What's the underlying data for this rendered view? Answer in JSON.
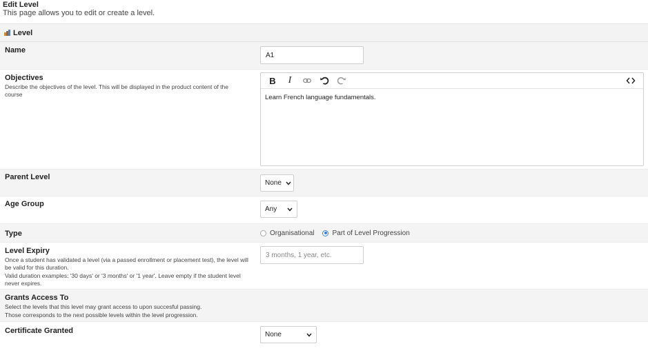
{
  "page": {
    "title": "Edit Level",
    "subtitle": "This page allows you to edit or create a level."
  },
  "section": {
    "title": "Level",
    "icon": "level-icon"
  },
  "fields": {
    "name": {
      "label": "Name",
      "value": "A1"
    },
    "objectives": {
      "label": "Objectives",
      "help": "Describe the objectives of the level. This will be displayed in the product content of the course",
      "content": "Learn French language fundamentals.",
      "toolbar": {
        "bold": "B",
        "italic": "I",
        "link_icon": "link-icon",
        "undo_icon": "undo-icon",
        "redo_icon": "redo-icon",
        "code_icon": "code-view-icon"
      }
    },
    "parent_level": {
      "label": "Parent Level",
      "value": "None"
    },
    "age_group": {
      "label": "Age Group",
      "value": "Any"
    },
    "type": {
      "label": "Type",
      "options": [
        "Organisational",
        "Part of Level Progression"
      ],
      "selected": "Part of Level Progression"
    },
    "level_expiry": {
      "label": "Level Expiry",
      "help1": "Once a student has validated a level (via a passed enrollment or placement test), the level will be valid for this duration.",
      "help2": "Valid duration examples: '30 days' or '3 months' or '1 year'. Leave empty if the student level never expires.",
      "placeholder": "3 months, 1 year, etc."
    },
    "grants_access": {
      "label": "Grants Access To",
      "help1": "Select the levels that this level may grant access to upon succesful passing.",
      "help2": "Those corresponds to the next possible levels within the level progression."
    },
    "certificate": {
      "label": "Certificate Granted",
      "value": "None"
    }
  },
  "colors": {
    "accent": "#3d7ee0",
    "row_shade": "#f4f4f4",
    "border": "#cfcfcf"
  }
}
